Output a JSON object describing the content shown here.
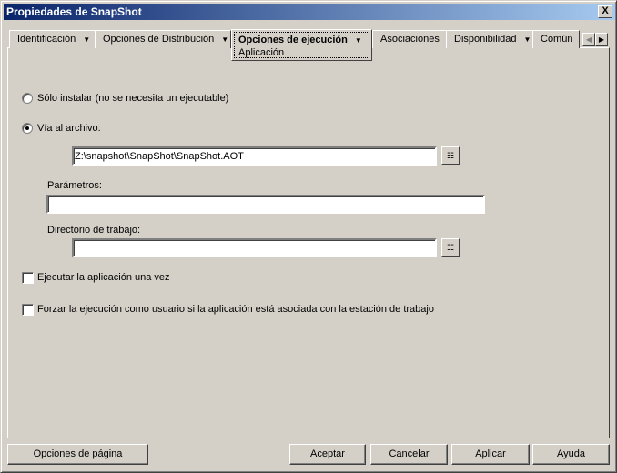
{
  "window": {
    "title": "Propiedades de SnapShot",
    "close_label": "X"
  },
  "tabs": [
    {
      "label": "Identificación"
    },
    {
      "label": "Opciones de Distribución"
    },
    {
      "label": "Opciones de ejecución",
      "active": true
    },
    {
      "label": "Asociaciones"
    },
    {
      "label": "Disponibilidad"
    },
    {
      "label": "Común"
    }
  ],
  "dropdown": {
    "items": [
      "Aplicación"
    ]
  },
  "form": {
    "radio_install_only": "Sólo instalar (no se necesita un ejecutable)",
    "radio_path": "Vía al archivo:",
    "path_value": "Z:\\snapshot\\SnapShot\\SnapShot.AOT",
    "params_label": "Parámetros:",
    "params_value": "",
    "workdir_label": "Directorio de trabajo:",
    "workdir_value": "",
    "check_run_once": "Ejecutar la aplicación una vez",
    "check_force_user": "Forzar la ejecución como usuario si la aplicación está asociada con la estación de trabajo"
  },
  "buttons": {
    "page_options": "Opciones de página",
    "ok": "Aceptar",
    "cancel": "Cancelar",
    "apply": "Aplicar",
    "help": "Ayuda"
  }
}
